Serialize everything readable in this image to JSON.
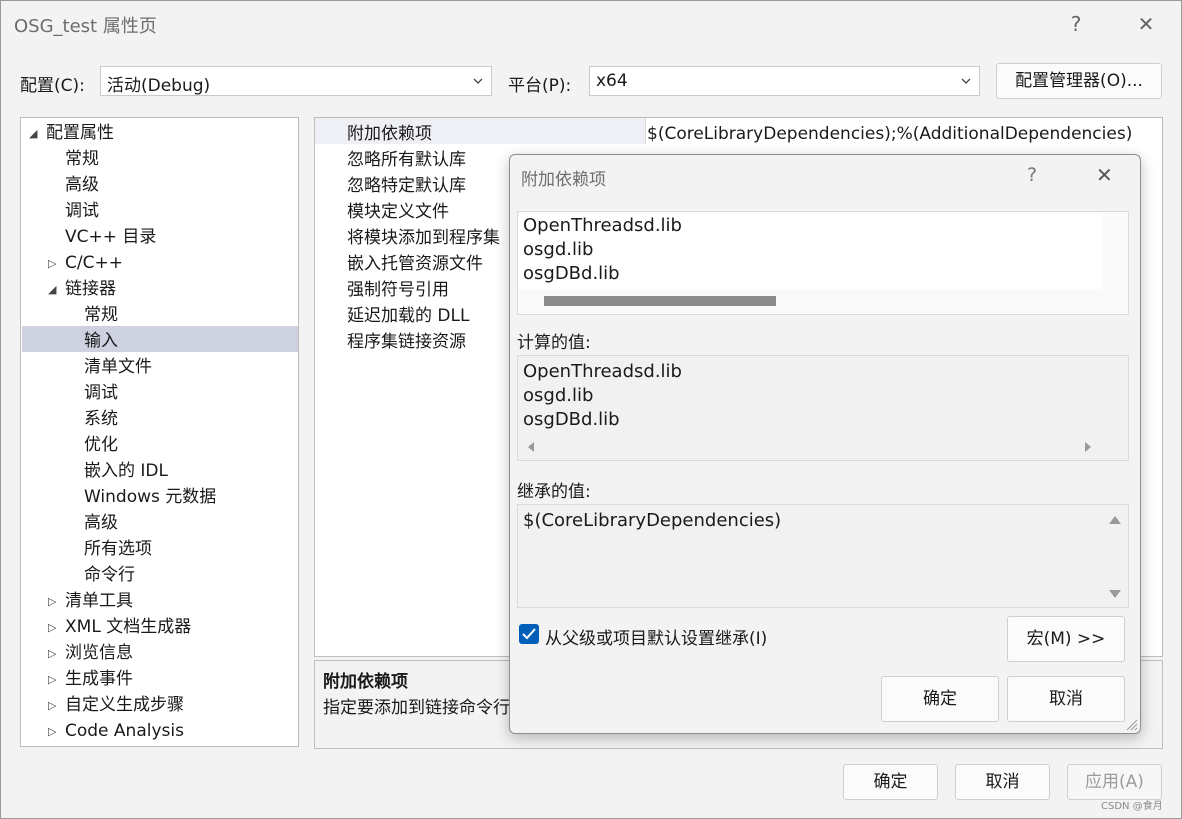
{
  "window": {
    "title": "OSG_test 属性页",
    "help_glyph": "?",
    "close_glyph": "✕"
  },
  "top": {
    "config_label": "配置(C):",
    "config_value": "活动(Debug)",
    "platform_label": "平台(P):",
    "platform_value": "x64",
    "config_manager_label": "配置管理器(O)..."
  },
  "tree": {
    "items": [
      {
        "label": "配置属性",
        "expander": "◢"
      },
      {
        "label": "常规"
      },
      {
        "label": "高级"
      },
      {
        "label": "调试"
      },
      {
        "label": "VC++ 目录"
      },
      {
        "label": "C/C++",
        "expander": "▷"
      },
      {
        "label": "链接器",
        "expander": "◢"
      },
      {
        "label": "常规"
      },
      {
        "label": "输入"
      },
      {
        "label": "清单文件"
      },
      {
        "label": "调试"
      },
      {
        "label": "系统"
      },
      {
        "label": "优化"
      },
      {
        "label": "嵌入的 IDL"
      },
      {
        "label": "Windows 元数据"
      },
      {
        "label": "高级"
      },
      {
        "label": "所有选项"
      },
      {
        "label": "命令行"
      },
      {
        "label": "清单工具",
        "expander": "▷"
      },
      {
        "label": "XML 文档生成器",
        "expander": "▷"
      },
      {
        "label": "浏览信息",
        "expander": "▷"
      },
      {
        "label": "生成事件",
        "expander": "▷"
      },
      {
        "label": "自定义生成步骤",
        "expander": "▷"
      },
      {
        "label": "Code Analysis",
        "expander": "▷"
      }
    ]
  },
  "grid": {
    "rows": [
      "附加依赖项",
      "忽略所有默认库",
      "忽略特定默认库",
      "模块定义文件",
      "将模块添加到程序集",
      "嵌入托管资源文件",
      "强制符号引用",
      "延迟加载的 DLL",
      "程序集链接资源"
    ],
    "first_value": "$(CoreLibraryDependencies);%(AdditionalDependencies)"
  },
  "description": {
    "title": "附加依赖项",
    "text": "指定要添加到链接命令行"
  },
  "footer": {
    "ok": "确定",
    "cancel": "取消",
    "apply": "应用(A)"
  },
  "dialog": {
    "title": "附加依赖项",
    "help_glyph": "?",
    "close_glyph": "✕",
    "edit_lines": [
      "OpenThreadsd.lib",
      "osgd.lib",
      "osgDBd.lib"
    ],
    "computed_label": "计算的值:",
    "computed_lines": [
      "OpenThreadsd.lib",
      "osgd.lib",
      "osgDBd.lib"
    ],
    "inherited_label": "继承的值:",
    "inherited_lines": [
      "$(CoreLibraryDependencies)"
    ],
    "inherit_checkbox_label": "从父级或项目默认设置继承(I)",
    "inherit_checked": true,
    "macro_button": "宏(M) >>",
    "ok": "确定",
    "cancel": "取消"
  },
  "watermark": "CSDN @食月",
  "colors": {
    "selection": "#cdd1e0",
    "checkbox": "#005fb8"
  }
}
